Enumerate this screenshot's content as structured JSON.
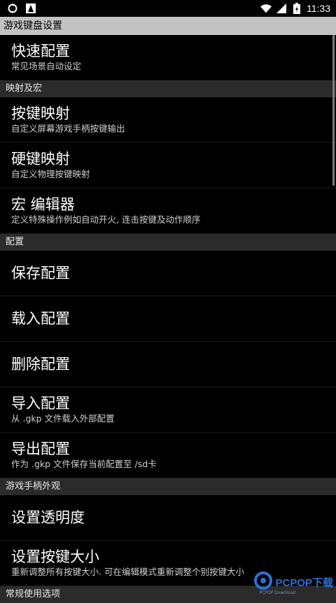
{
  "status": {
    "time": "11:33",
    "icons": [
      "sync-icon",
      "app-icon",
      "wifi-icon",
      "signal-icon",
      "battery-icon"
    ]
  },
  "title": "游戏键盘设置",
  "sections": {
    "quick": {
      "title": "快速配置",
      "sub": "常见场景自动设定"
    },
    "mapping_header": "映射及宏",
    "key_mapping": {
      "title": "按键映射",
      "sub": "自定义屏幕游戏手柄按键输出"
    },
    "hard_mapping": {
      "title": "硬键映射",
      "sub": "自定义物理按键映射"
    },
    "macro": {
      "title": "宏 编辑器",
      "sub": "定义特殊操作例如自动开火, 连击按键及动作顺序"
    },
    "config_header": "配置",
    "save_config": {
      "title": "保存配置"
    },
    "load_config": {
      "title": "载入配置"
    },
    "delete_config": {
      "title": "删除配置"
    },
    "import_config": {
      "title": "导入配置",
      "sub": "从 .gkp 文件载入外部配置"
    },
    "export_config": {
      "title": "导出配置",
      "sub": "作为 .gkp 文件保存当前配置至 /sd卡"
    },
    "appearance_header": "游戏手柄外观",
    "transparency": {
      "title": "设置透明度"
    },
    "key_size": {
      "title": "设置按键大小",
      "sub": "重新调整所有按键大小. 可在编辑模式重新调整个别按键大小"
    },
    "common_header": "常规使用选项"
  },
  "watermark": {
    "text": "PCPOP下载",
    "sub": "PCPOP Download"
  },
  "colors": {
    "titlebar": "#c2c2c2",
    "section": "#2b2b2b",
    "watermark": "#2e6fd6"
  }
}
